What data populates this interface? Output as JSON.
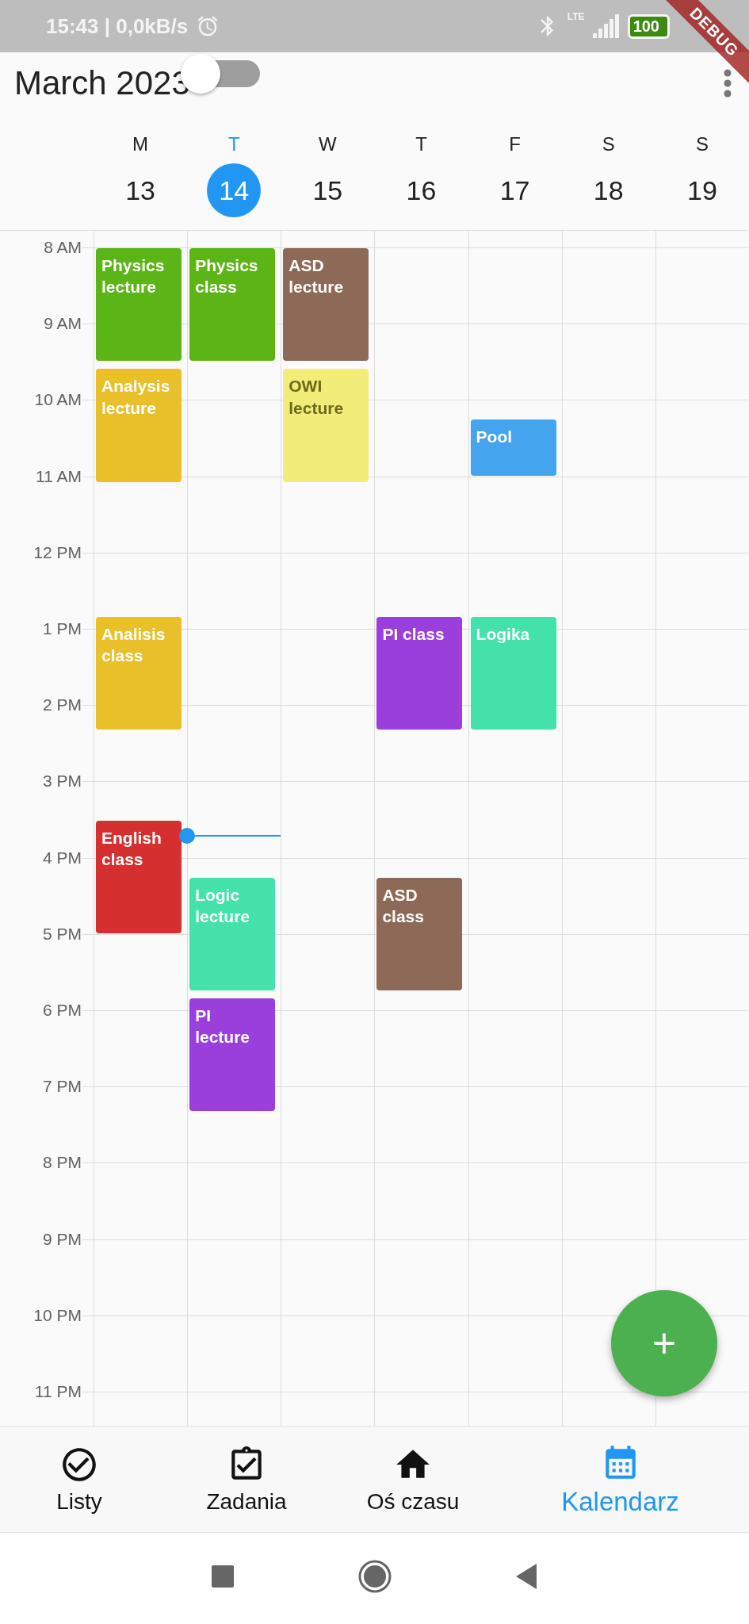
{
  "status_bar": {
    "text": "15:43 | 0,0kB/s",
    "network": "LTE",
    "battery": "100"
  },
  "debug_banner": "DEBUG",
  "header": {
    "title": "March 2023",
    "toggle": {
      "on": false
    }
  },
  "days": [
    {
      "letter": "M",
      "number": "13",
      "selected": false
    },
    {
      "letter": "T",
      "number": "14",
      "selected": true
    },
    {
      "letter": "W",
      "number": "15",
      "selected": false
    },
    {
      "letter": "T",
      "number": "16",
      "selected": false
    },
    {
      "letter": "F",
      "number": "17",
      "selected": false
    },
    {
      "letter": "S",
      "number": "18",
      "selected": false
    },
    {
      "letter": "S",
      "number": "19",
      "selected": false
    }
  ],
  "hours": [
    "8 AM",
    "9 AM",
    "10 AM",
    "11 AM",
    "12 PM",
    "1 PM",
    "2 PM",
    "3 PM",
    "4 PM",
    "5 PM",
    "6 PM",
    "7 PM",
    "8 PM",
    "9 PM",
    "10 PM",
    "11 PM"
  ],
  "events": [
    {
      "title": "Physics lecture",
      "color": "#5cb516"
    },
    {
      "title": "Physics class",
      "color": "#5cb516"
    },
    {
      "title": "ASD lecture",
      "color": "#8d6a58"
    },
    {
      "title": "Analysis lecture",
      "color": "#e9c02a"
    },
    {
      "title": "OWI lecture",
      "color": "#f2ec78"
    },
    {
      "title": "Pool",
      "color": "#44a4ee"
    },
    {
      "title": "Analisis class",
      "color": "#e9c02a"
    },
    {
      "title": "PI class",
      "color": "#9a3fdc"
    },
    {
      "title": "Logika",
      "color": "#44e2aa"
    },
    {
      "title": "English class",
      "color": "#d52f2f"
    },
    {
      "title": "Logic lecture",
      "color": "#44e2aa"
    },
    {
      "title": "ASD class",
      "color": "#8d6a58"
    },
    {
      "title": "PI lecture",
      "color": "#9a3fdc"
    }
  ],
  "fab": {
    "label": "+"
  },
  "bottom_nav": [
    {
      "label": "Listy",
      "selected": false
    },
    {
      "label": "Zadania",
      "selected": false
    },
    {
      "label": "Oś czasu",
      "selected": false
    },
    {
      "label": "Kalendarz",
      "selected": true
    }
  ]
}
